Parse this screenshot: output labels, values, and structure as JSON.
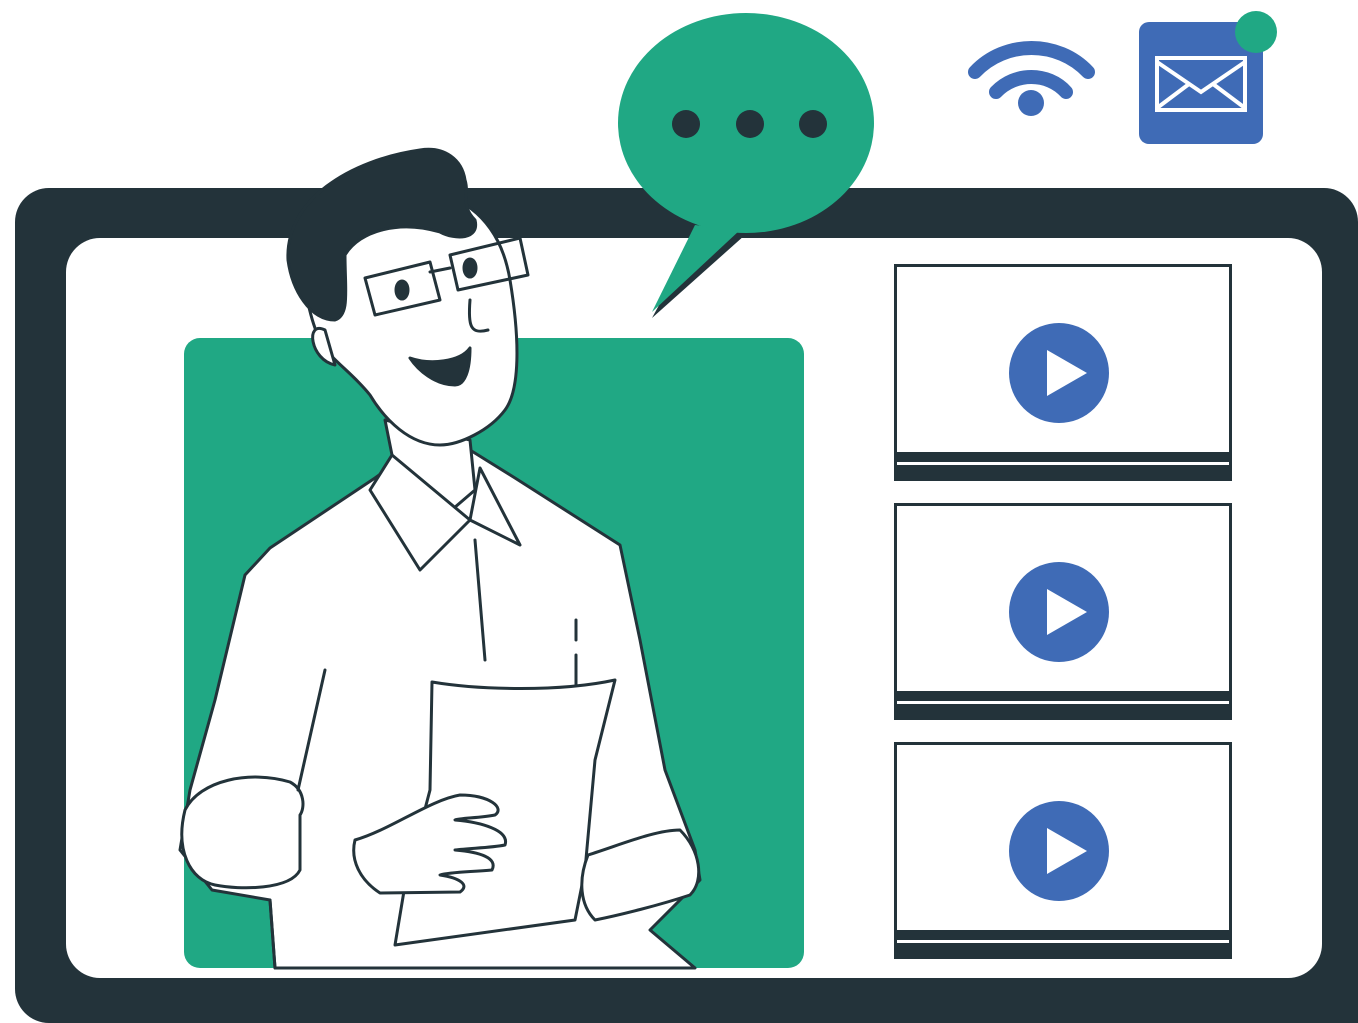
{
  "colors": {
    "monitor_frame": "#23333a",
    "video_background": "#20a884",
    "accent_blue": "#3f6bb6",
    "speech_bubble": "#20a884",
    "notification_dot": "#20a884"
  },
  "icons": {
    "wifi": "wifi-icon",
    "mail": "envelope-icon",
    "speech": "speech-bubble-ellipsis-icon",
    "play": "play-icon"
  },
  "playlist": {
    "items": [
      {
        "icon": "play-icon"
      },
      {
        "icon": "play-icon"
      },
      {
        "icon": "play-icon"
      }
    ]
  }
}
